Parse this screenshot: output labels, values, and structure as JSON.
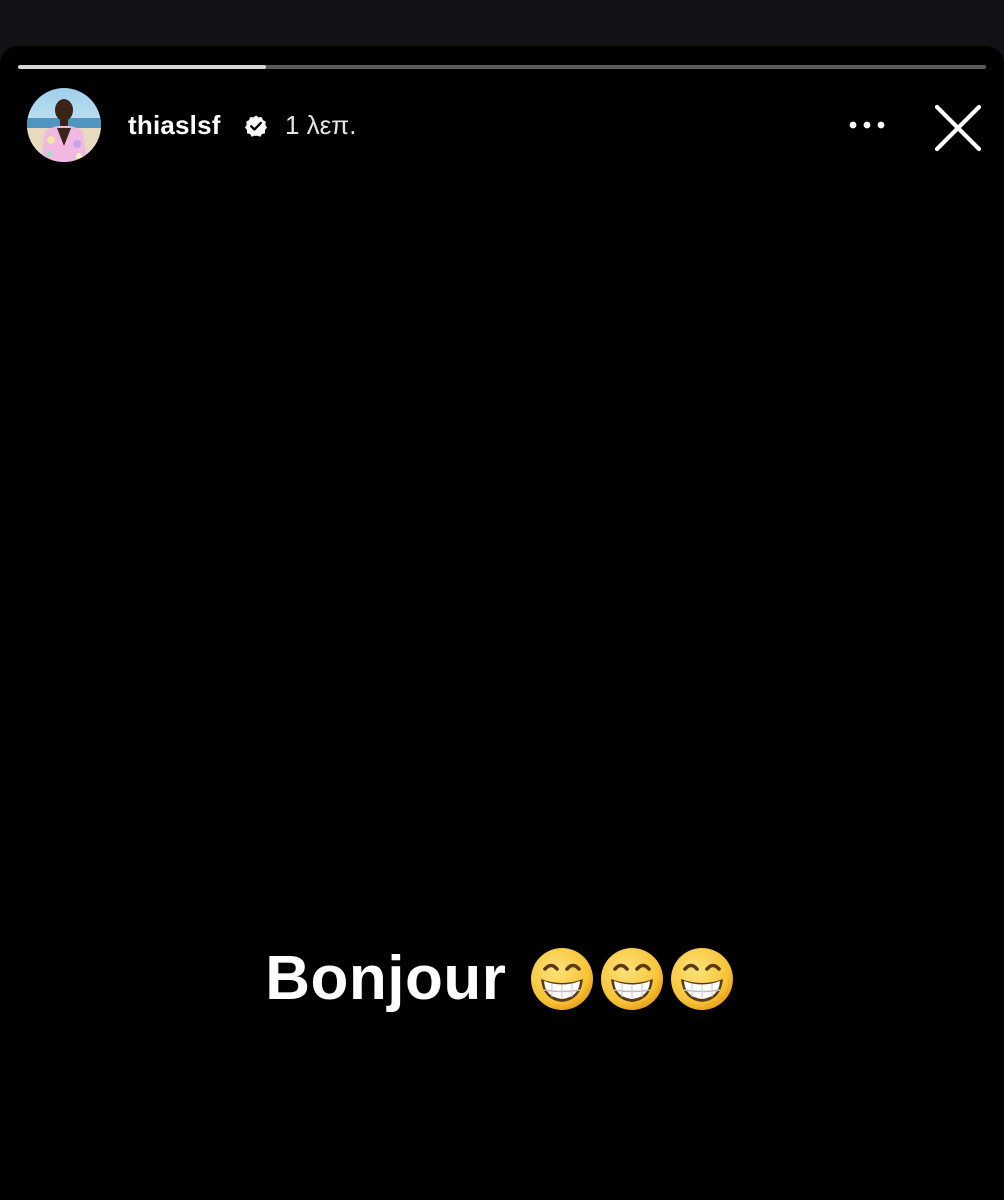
{
  "story": {
    "progress_fraction": 0.256,
    "username": "thiaslsf",
    "verified": true,
    "timestamp": "1 λεπ.",
    "caption": "Bonjour",
    "caption_emojis": [
      "grinning-face-with-smiling-eyes",
      "grinning-face-with-smiling-eyes",
      "grinning-face-with-smiling-eyes"
    ],
    "icons": {
      "verified": "verified-badge-icon",
      "more": "more-options-icon",
      "close": "close-icon"
    },
    "colors": {
      "background": "#000000",
      "progress_track": "#5a5a5a",
      "progress_fill": "#d8d8d8",
      "text": "#ffffff"
    }
  }
}
